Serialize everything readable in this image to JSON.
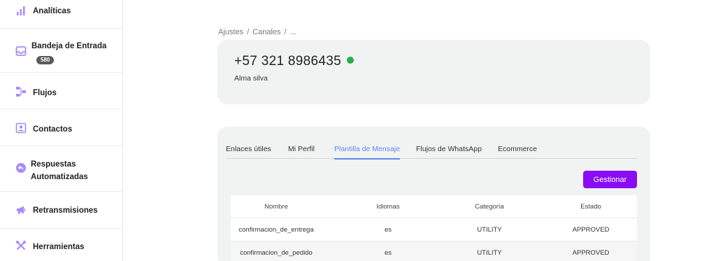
{
  "sidebar": {
    "items": [
      {
        "label": "Analíticas",
        "icon": "bar-chart-icon"
      },
      {
        "label": "Bandeja de Entrada",
        "icon": "inbox-icon",
        "badge": "580"
      },
      {
        "label": "Flujos",
        "icon": "flow-icon"
      },
      {
        "label": "Contactos",
        "icon": "contact-card-icon"
      },
      {
        "label": "Respuestas Automatizadas",
        "icon": "reply-icon"
      },
      {
        "label": "Retransmisiones",
        "icon": "megaphone-icon"
      },
      {
        "label": "Herramientas",
        "icon": "tools-icon"
      }
    ]
  },
  "breadcrumb": [
    "Ajustes",
    "Canales",
    "..."
  ],
  "channel": {
    "phone": "+57 321 8986435",
    "status_color": "#2eaa4f",
    "owner": "Alma silva"
  },
  "tabs": [
    {
      "label": "Enlaces útiles",
      "active": false
    },
    {
      "label": "Mi Perfil",
      "active": false
    },
    {
      "label": "Plantilla de Mensaje",
      "active": true
    },
    {
      "label": "Flujos de WhatsApp",
      "active": false
    },
    {
      "label": "Ecommerce",
      "active": false
    }
  ],
  "manage_button": "Gestionar",
  "table": {
    "headers": [
      "Nombre",
      "Idiomas",
      "Categoría",
      "Estado"
    ],
    "rows": [
      [
        "confirmacion_de_entrega",
        "es",
        "UTILITY",
        "APPROVED"
      ],
      [
        "confirmacion_de_pedido",
        "es",
        "UTILITY",
        "APPROVED"
      ]
    ]
  },
  "colors": {
    "accent": "#8a0cf5",
    "tab_active": "#5b8def",
    "icon": "#a78bfa"
  }
}
